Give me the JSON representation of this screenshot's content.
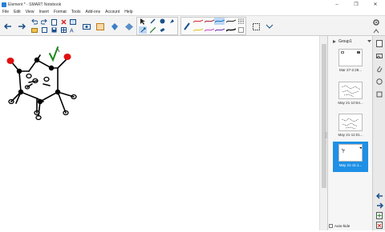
{
  "window": {
    "title": "Element * - SMART Notebook",
    "minimize": "–",
    "maximize": "❐",
    "close": "✕"
  },
  "menu": [
    "File",
    "Edit",
    "View",
    "Insert",
    "Format",
    "Tools",
    "Add-ons",
    "Account",
    "Help"
  ],
  "sidebar": {
    "group_label": "Group1",
    "pages": [
      {
        "caption": "Mar 27-2:28..."
      },
      {
        "caption": "May 21-10:54..."
      },
      {
        "caption": "May 21-11:01..."
      },
      {
        "caption": "May 21-11:1..."
      }
    ],
    "autohide_label": "Auto-hide"
  },
  "colors": {
    "selected_thumb": "#1e90e6",
    "ink": "#000000",
    "red_ink": "#e01010",
    "green_ink": "#1a8a1a"
  }
}
